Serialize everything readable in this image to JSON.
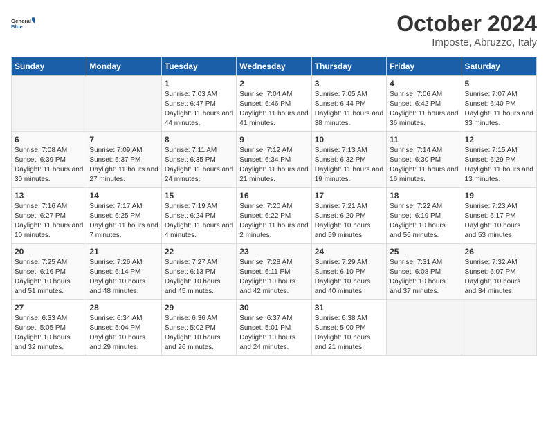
{
  "logo": {
    "line1": "General",
    "line2": "Blue"
  },
  "title": "October 2024",
  "location": "Imposte, Abruzzo, Italy",
  "days_of_week": [
    "Sunday",
    "Monday",
    "Tuesday",
    "Wednesday",
    "Thursday",
    "Friday",
    "Saturday"
  ],
  "weeks": [
    [
      {
        "day": "",
        "info": ""
      },
      {
        "day": "",
        "info": ""
      },
      {
        "day": "1",
        "info": "Sunrise: 7:03 AM\nSunset: 6:47 PM\nDaylight: 11 hours and 44 minutes."
      },
      {
        "day": "2",
        "info": "Sunrise: 7:04 AM\nSunset: 6:46 PM\nDaylight: 11 hours and 41 minutes."
      },
      {
        "day": "3",
        "info": "Sunrise: 7:05 AM\nSunset: 6:44 PM\nDaylight: 11 hours and 38 minutes."
      },
      {
        "day": "4",
        "info": "Sunrise: 7:06 AM\nSunset: 6:42 PM\nDaylight: 11 hours and 36 minutes."
      },
      {
        "day": "5",
        "info": "Sunrise: 7:07 AM\nSunset: 6:40 PM\nDaylight: 11 hours and 33 minutes."
      }
    ],
    [
      {
        "day": "6",
        "info": "Sunrise: 7:08 AM\nSunset: 6:39 PM\nDaylight: 11 hours and 30 minutes."
      },
      {
        "day": "7",
        "info": "Sunrise: 7:09 AM\nSunset: 6:37 PM\nDaylight: 11 hours and 27 minutes."
      },
      {
        "day": "8",
        "info": "Sunrise: 7:11 AM\nSunset: 6:35 PM\nDaylight: 11 hours and 24 minutes."
      },
      {
        "day": "9",
        "info": "Sunrise: 7:12 AM\nSunset: 6:34 PM\nDaylight: 11 hours and 21 minutes."
      },
      {
        "day": "10",
        "info": "Sunrise: 7:13 AM\nSunset: 6:32 PM\nDaylight: 11 hours and 19 minutes."
      },
      {
        "day": "11",
        "info": "Sunrise: 7:14 AM\nSunset: 6:30 PM\nDaylight: 11 hours and 16 minutes."
      },
      {
        "day": "12",
        "info": "Sunrise: 7:15 AM\nSunset: 6:29 PM\nDaylight: 11 hours and 13 minutes."
      }
    ],
    [
      {
        "day": "13",
        "info": "Sunrise: 7:16 AM\nSunset: 6:27 PM\nDaylight: 11 hours and 10 minutes."
      },
      {
        "day": "14",
        "info": "Sunrise: 7:17 AM\nSunset: 6:25 PM\nDaylight: 11 hours and 7 minutes."
      },
      {
        "day": "15",
        "info": "Sunrise: 7:19 AM\nSunset: 6:24 PM\nDaylight: 11 hours and 4 minutes."
      },
      {
        "day": "16",
        "info": "Sunrise: 7:20 AM\nSunset: 6:22 PM\nDaylight: 11 hours and 2 minutes."
      },
      {
        "day": "17",
        "info": "Sunrise: 7:21 AM\nSunset: 6:20 PM\nDaylight: 10 hours and 59 minutes."
      },
      {
        "day": "18",
        "info": "Sunrise: 7:22 AM\nSunset: 6:19 PM\nDaylight: 10 hours and 56 minutes."
      },
      {
        "day": "19",
        "info": "Sunrise: 7:23 AM\nSunset: 6:17 PM\nDaylight: 10 hours and 53 minutes."
      }
    ],
    [
      {
        "day": "20",
        "info": "Sunrise: 7:25 AM\nSunset: 6:16 PM\nDaylight: 10 hours and 51 minutes."
      },
      {
        "day": "21",
        "info": "Sunrise: 7:26 AM\nSunset: 6:14 PM\nDaylight: 10 hours and 48 minutes."
      },
      {
        "day": "22",
        "info": "Sunrise: 7:27 AM\nSunset: 6:13 PM\nDaylight: 10 hours and 45 minutes."
      },
      {
        "day": "23",
        "info": "Sunrise: 7:28 AM\nSunset: 6:11 PM\nDaylight: 10 hours and 42 minutes."
      },
      {
        "day": "24",
        "info": "Sunrise: 7:29 AM\nSunset: 6:10 PM\nDaylight: 10 hours and 40 minutes."
      },
      {
        "day": "25",
        "info": "Sunrise: 7:31 AM\nSunset: 6:08 PM\nDaylight: 10 hours and 37 minutes."
      },
      {
        "day": "26",
        "info": "Sunrise: 7:32 AM\nSunset: 6:07 PM\nDaylight: 10 hours and 34 minutes."
      }
    ],
    [
      {
        "day": "27",
        "info": "Sunrise: 6:33 AM\nSunset: 5:05 PM\nDaylight: 10 hours and 32 minutes."
      },
      {
        "day": "28",
        "info": "Sunrise: 6:34 AM\nSunset: 5:04 PM\nDaylight: 10 hours and 29 minutes."
      },
      {
        "day": "29",
        "info": "Sunrise: 6:36 AM\nSunset: 5:02 PM\nDaylight: 10 hours and 26 minutes."
      },
      {
        "day": "30",
        "info": "Sunrise: 6:37 AM\nSunset: 5:01 PM\nDaylight: 10 hours and 24 minutes."
      },
      {
        "day": "31",
        "info": "Sunrise: 6:38 AM\nSunset: 5:00 PM\nDaylight: 10 hours and 21 minutes."
      },
      {
        "day": "",
        "info": ""
      },
      {
        "day": "",
        "info": ""
      }
    ]
  ]
}
